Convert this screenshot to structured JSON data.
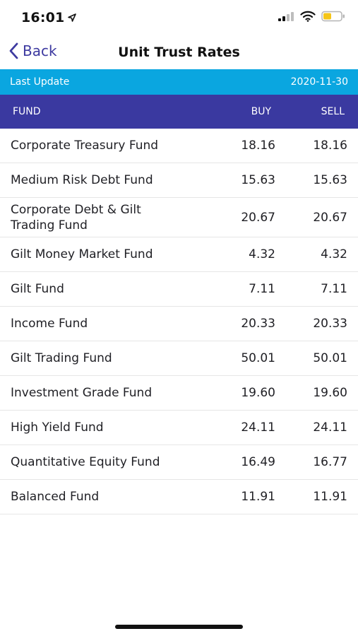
{
  "status_bar": {
    "time": "16:01"
  },
  "nav": {
    "back_label": "Back",
    "title": "Unit Trust Rates"
  },
  "update": {
    "label": "Last Update",
    "date": "2020-11-30"
  },
  "table": {
    "headers": {
      "fund": "FUND",
      "buy": "BUY",
      "sell": "SELL"
    },
    "rows": [
      {
        "fund": "Corporate Treasury Fund",
        "buy": "18.16",
        "sell": "18.16"
      },
      {
        "fund": "Medium Risk Debt Fund",
        "buy": "15.63",
        "sell": "15.63"
      },
      {
        "fund": "Corporate Debt & Gilt Trading Fund",
        "buy": "20.67",
        "sell": "20.67"
      },
      {
        "fund": "Gilt Money Market Fund",
        "buy": "4.32",
        "sell": "4.32"
      },
      {
        "fund": "Gilt Fund",
        "buy": "7.11",
        "sell": "7.11"
      },
      {
        "fund": "Income Fund",
        "buy": "20.33",
        "sell": "20.33"
      },
      {
        "fund": "Gilt Trading Fund",
        "buy": "50.01",
        "sell": "50.01"
      },
      {
        "fund": "Investment Grade Fund",
        "buy": "19.60",
        "sell": "19.60"
      },
      {
        "fund": "High Yield Fund",
        "buy": "24.11",
        "sell": "24.11"
      },
      {
        "fund": "Quantitative Equity Fund",
        "buy": "16.49",
        "sell": "16.77"
      },
      {
        "fund": "Balanced Fund",
        "buy": "11.91",
        "sell": "11.91"
      }
    ]
  },
  "colors": {
    "accent": "#3a39a0",
    "update_strip": "#0aa6e0",
    "battery": "#f5c518"
  },
  "icons": {
    "location": "location-arrow-icon",
    "signal": "cellular-signal-icon",
    "wifi": "wifi-icon",
    "battery": "battery-icon",
    "back": "chevron-left-icon"
  }
}
